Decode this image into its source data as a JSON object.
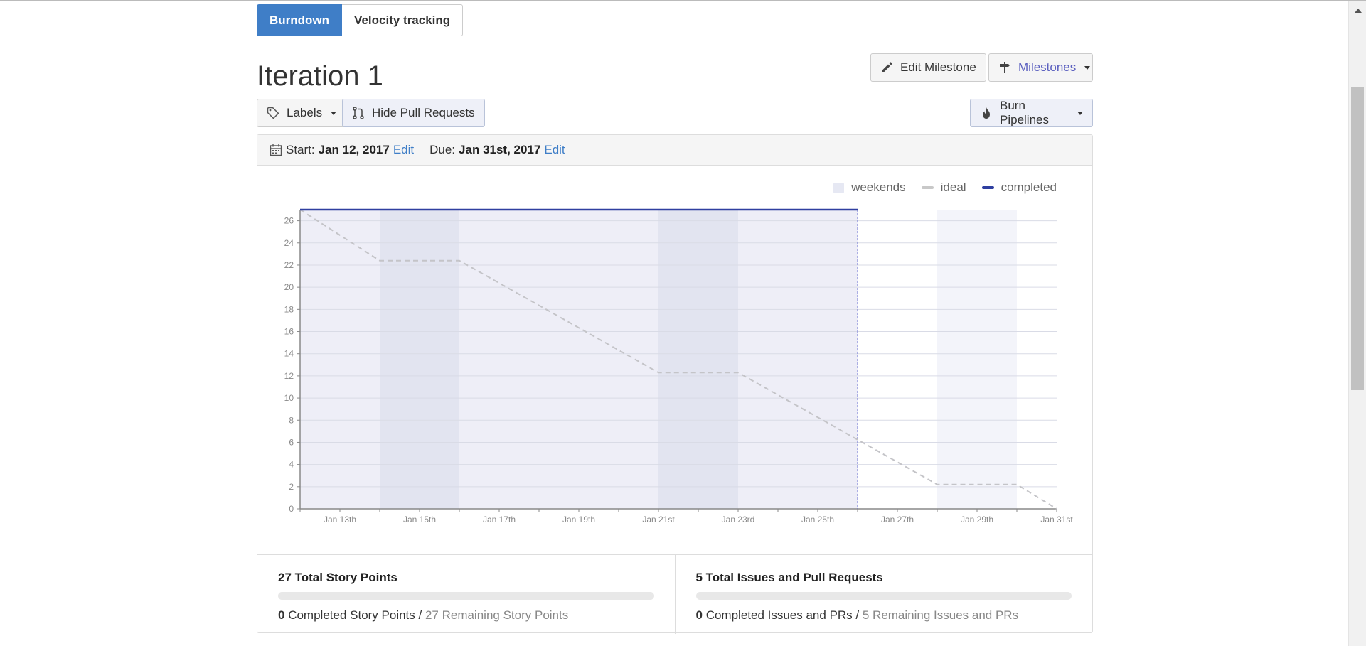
{
  "tabs": [
    {
      "label": "Burndown",
      "active": true
    },
    {
      "label": "Velocity tracking",
      "active": false
    }
  ],
  "page_title": "Iteration 1",
  "actions": {
    "edit_milestone": "Edit Milestone",
    "milestones": "Milestones",
    "labels": "Labels",
    "hide_pull_requests": "Hide Pull Requests",
    "burn_pipelines": "Burn Pipelines"
  },
  "dates": {
    "start_label": "Start:",
    "start_value": "Jan 12, 2017",
    "due_label": "Due:",
    "due_value": "Jan 31st, 2017",
    "edit": "Edit"
  },
  "legend": {
    "weekends": "weekends",
    "ideal": "ideal",
    "completed": "completed"
  },
  "chart_data": {
    "type": "line",
    "x": [
      "Jan 12",
      "Jan 13",
      "Jan 14",
      "Jan 15",
      "Jan 16",
      "Jan 17",
      "Jan 18",
      "Jan 19",
      "Jan 20",
      "Jan 21",
      "Jan 22",
      "Jan 23",
      "Jan 24",
      "Jan 25",
      "Jan 26",
      "Jan 27",
      "Jan 28",
      "Jan 29",
      "Jan 30",
      "Jan 31"
    ],
    "x_tick_labels": [
      "Jan 13th",
      "Jan 15th",
      "Jan 17th",
      "Jan 19th",
      "Jan 21st",
      "Jan 23rd",
      "Jan 25th",
      "Jan 27th",
      "Jan 29th",
      "Jan 31st"
    ],
    "ylim": [
      0,
      27
    ],
    "y_ticks": [
      0,
      2,
      4,
      6,
      8,
      10,
      12,
      14,
      16,
      18,
      20,
      22,
      24,
      26
    ],
    "weekends": [
      [
        "Jan 14",
        "Jan 16"
      ],
      [
        "Jan 21",
        "Jan 23"
      ],
      [
        "Jan 28",
        "Jan 30"
      ]
    ],
    "today": "Jan 26",
    "series": [
      {
        "name": "ideal",
        "style": "dashed",
        "color": "#c4c4c8",
        "points": [
          [
            "Jan 12",
            27
          ],
          [
            "Jan 14",
            22.4
          ],
          [
            "Jan 16",
            22.4
          ],
          [
            "Jan 21",
            12.3
          ],
          [
            "Jan 23",
            12.3
          ],
          [
            "Jan 28",
            2.2
          ],
          [
            "Jan 30",
            2.2
          ],
          [
            "Jan 31",
            0
          ]
        ]
      },
      {
        "name": "completed",
        "style": "solid",
        "color": "#2f3fa0",
        "points": [
          [
            "Jan 12",
            27
          ],
          [
            "Jan 26",
            27
          ]
        ]
      }
    ],
    "grid": true
  },
  "stats": {
    "story": {
      "title": "27 Total Story Points",
      "completed_num": "0",
      "completed_text": " Completed Story Points",
      "sep": " / ",
      "remaining_text": "27 Remaining Story Points",
      "progress": 0
    },
    "issues": {
      "title": "5 Total Issues and Pull Requests",
      "completed_num": "0",
      "completed_text": " Completed Issues and PRs",
      "sep": " / ",
      "remaining_text": "5 Remaining Issues and PRs",
      "progress": 0
    }
  },
  "colors": {
    "accent": "#3f7ec7",
    "completed": "#2f3fa0",
    "weekend_shade": "#e6e8f3",
    "elapsed_shade": "#eeeef7"
  }
}
